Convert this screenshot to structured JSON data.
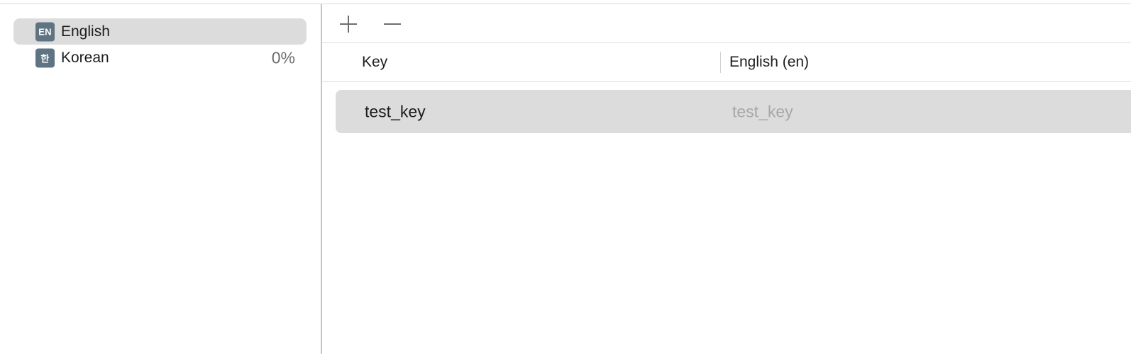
{
  "sidebar": {
    "languages": [
      {
        "badge": "EN",
        "name": "English",
        "percent": "",
        "selected": true
      },
      {
        "badge": "한",
        "name": "Korean",
        "percent": "0%",
        "selected": false
      }
    ]
  },
  "toolbar": {
    "add_icon": "plus-icon",
    "remove_icon": "minus-icon"
  },
  "table": {
    "columns": [
      "Key",
      "English (en)"
    ],
    "rows": [
      {
        "key": "test_key",
        "value": "test_key"
      }
    ]
  },
  "colors": {
    "badge": "#5f7482",
    "selection": "#dcdcdc",
    "placeholder_text": "#a8a8a8"
  }
}
